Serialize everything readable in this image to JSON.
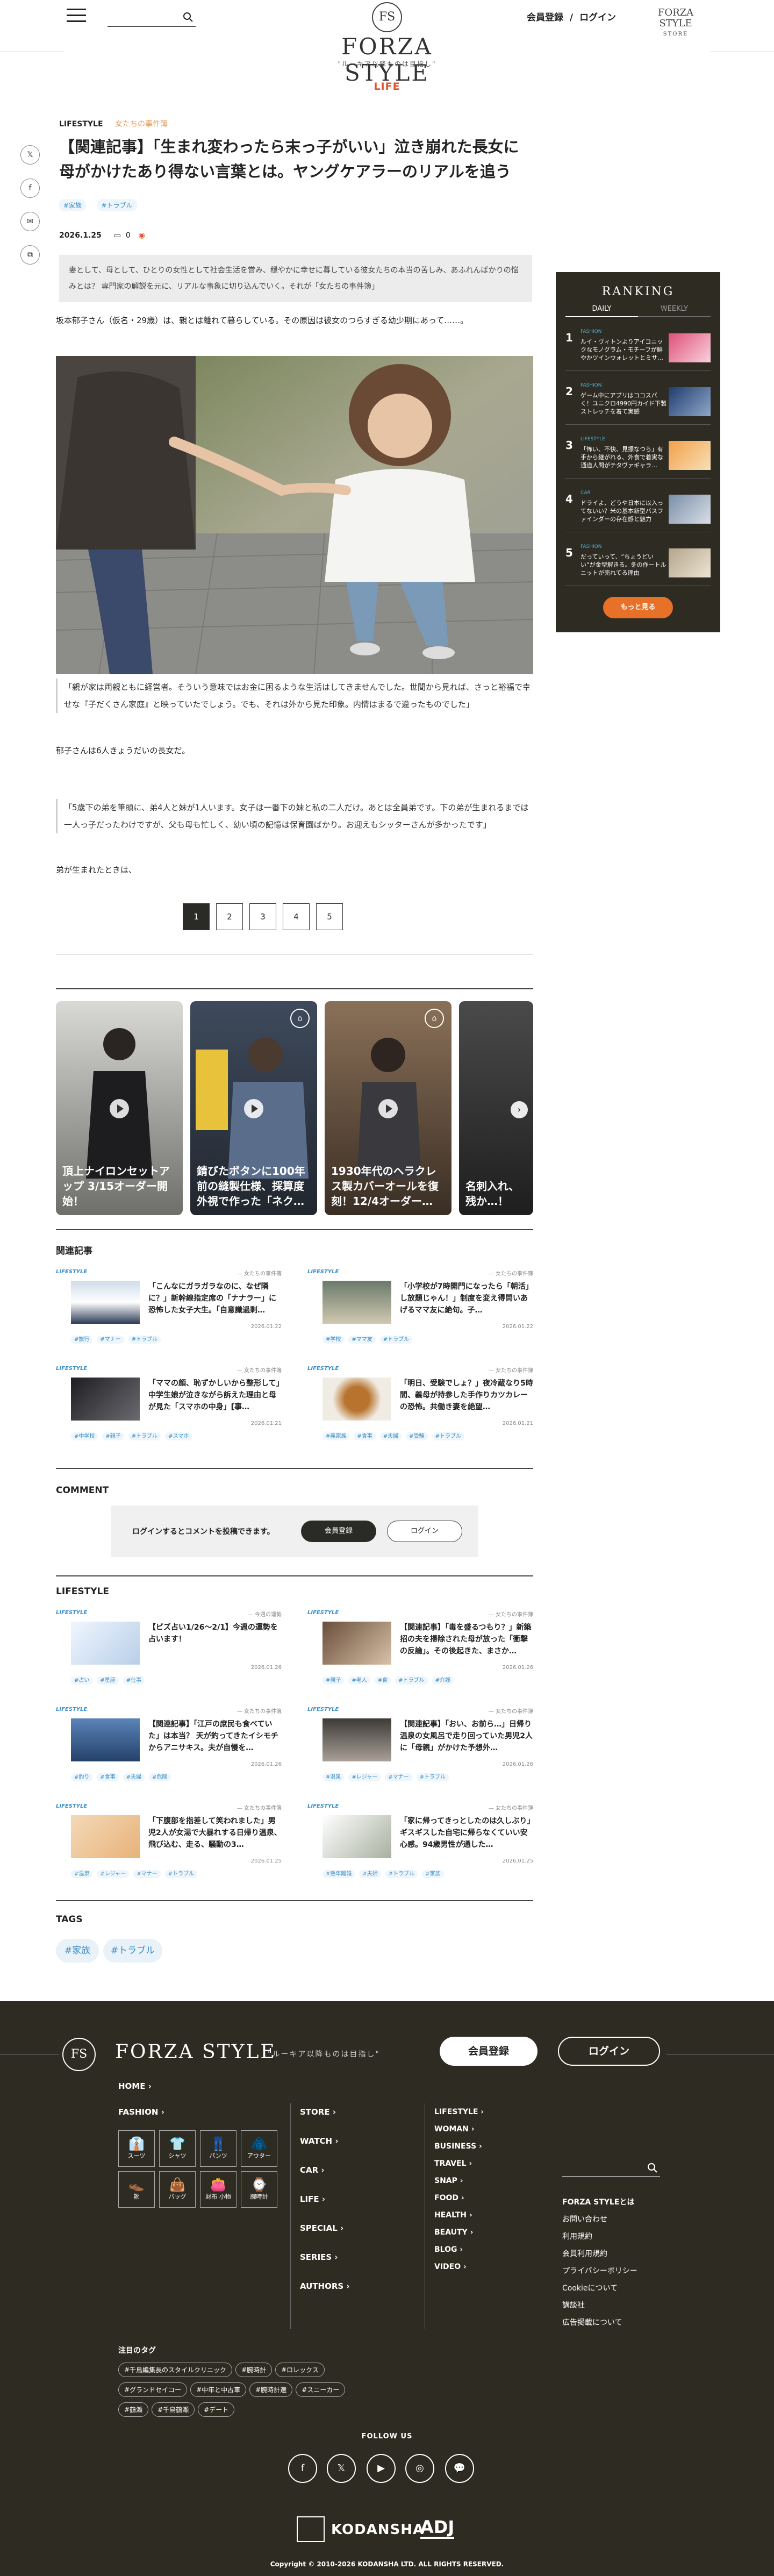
{
  "header": {
    "logo_mark": "FS",
    "logo_text": "FORZA STYLE",
    "logo_sub": "\"ルーキア以降ものは目指し\"",
    "register": "会員登録",
    "sep": "/",
    "login": "ログイン",
    "store_logo": "FORZA STYLE",
    "store_sub": "STORE",
    "category": "LIFE"
  },
  "share": {
    "x": "𝕏",
    "fb": "f",
    "mail": "✉",
    "copy": "⧉"
  },
  "article": {
    "crumb_main": "LIFESTYLE",
    "crumb_sub": "女たちの事件簿",
    "title": "【関連記事】「生まれ変わったら末っ子がいい」泣き崩れた長女に母がかけたあり得ない言葉とは。ヤングケアラーのリアルを追う",
    "tags": [
      "#家族",
      "#トラブル"
    ],
    "date": "2026.1.25",
    "comments": "0",
    "lead": "妻として、母として、ひとりの女性として社会生活を営み、穏やかに幸せに暮している彼女たちの本当の苦しみ、あふれんばかりの悩みとは？ 専門家の解説を元に、リアルな事象に切り込んでいく。それが「女たちの事件簿」",
    "p1": "坂本郁子さん（仮名・29歳）は、親とは離れて暮らしている。その原因は彼女のつらすぎる幼少期にあって……。",
    "quote1": "「親が家は両親ともに経営者。そういう意味ではお金に困るような生活はしてきませんでした。世間から見れば、さっと裕福で幸せな『子だくさん家庭』と映っていたでしょう。でも、それは外から見た印象。内情はまるで違ったものでした」",
    "p2": "郁子さんは6人きょうだいの長女だ。",
    "quote2": "「5歳下の弟を筆頭に、弟4人と妹が1人います。女子は一番下の妹と私の二人だけ。あとは全員弟です。下の弟が生まれるまでは一人っ子だったわけですが、父も母も忙しく、幼い頃の記憶は保育園ばかり。お迎えもシッターさんが多かったです」",
    "p3": "弟が生まれたときは、",
    "pages": [
      "1",
      "2",
      "3",
      "4",
      "5"
    ]
  },
  "ranking": {
    "title": "RANKING",
    "tab_daily": "DAILY",
    "tab_weekly": "WEEKLY",
    "items": [
      {
        "num": "1",
        "cat": "FASHION",
        "text": "ルイ・ヴィトンよりアイコニックなモノグラム・モチーフが鮮やかツインウォレットとミサ…"
      },
      {
        "num": "2",
        "cat": "FASHION",
        "text": "ゲーム中にアプリはココスパく！ユニクロ4990円カイド下製ストレッチを着て実感"
      },
      {
        "num": "3",
        "cat": "LIFESTYLE",
        "text": "「怖い、不快、見振なつら」有手から継がれる、外食で着実な通道人問がテタヴァギャラ…"
      },
      {
        "num": "4",
        "cat": "CAR",
        "text": "ドライよ、どうや日本に以入ってないい？米の基本新型バスファインダーの存在感と魅力"
      },
      {
        "num": "5",
        "cat": "FASHION",
        "text": "だっていって、“ちょうどいい”が金型解きる。冬の作ートルニットが売れてる理由"
      }
    ],
    "more": "もっと見る"
  },
  "videos": [
    {
      "title": "頂上ナイロンセットアップ 3/15オーダー開始！"
    },
    {
      "title": "錆びたボタンに100年前の縫製仕様、採算度外視で作った「ネク…"
    },
    {
      "title": "1930年代のヘラクレス製カバーオールを復刻！12/4オーダー…"
    },
    {
      "title": "名刺入れ、残か…！"
    }
  ],
  "related": {
    "heading": "関連記事",
    "items": [
      {
        "label": "LIFESTYLE",
        "sub": "— 女たちの事件簿",
        "title": "「こんなにガラガラなのに、なぜ隣に？」新幹線指定席の「ナナラー」に恐怖した女子大生。「自意識過剰…",
        "date": "2026.01.22",
        "tags": [
          "#旅行",
          "#マナー",
          "#トラブル"
        ]
      },
      {
        "label": "LIFESTYLE",
        "sub": "— 女たちの事件簿",
        "title": "「小学校が7時開門になったら「朝活」し放題じゃん！」制度を変え得問いあげるママ友に絶句。子…",
        "date": "2026.01.22",
        "tags": [
          "#学校",
          "#ママ友",
          "#トラブル"
        ]
      },
      {
        "label": "LIFESTYLE",
        "sub": "— 女たちの事件簿",
        "title": "「ママの顔、恥ずかしいから整形して」中学生娘が泣きながら訴えた理由と母が見た「スマホの中身」[事…",
        "date": "2026.01.21",
        "tags": [
          "#中学校",
          "#親子",
          "#トラブル",
          "#スマホ"
        ]
      },
      {
        "label": "LIFESTYLE",
        "sub": "— 女たちの事件簿",
        "title": "「明日、受験でしょ？」夜冷蔵なり5時間、義母が持参した手作りカツカレーの恐怖。共働き妻を絶望…",
        "date": "2026.01.21",
        "tags": [
          "#義家族",
          "#食事",
          "#夫婦",
          "#受験",
          "#トラブル"
        ]
      }
    ]
  },
  "comment": {
    "heading": "COMMENT",
    "prompt": "ログインするとコメントを投稿できます。",
    "register": "会員登録",
    "login": "ログイン"
  },
  "lifestyle": {
    "heading": "LIFESTYLE",
    "items": [
      {
        "label": "LIFESTYLE",
        "sub": "— 今週の運勢",
        "title": "【ビズ占い1/26〜2/1】今週の運勢を占います！",
        "date": "2026.01.26",
        "tags": [
          "#占い",
          "#星座",
          "#仕事"
        ]
      },
      {
        "label": "LIFESTYLE",
        "sub": "— 女たちの事件簿",
        "title": "【関連記事】「毒を盛るつもり？」新築招の夫を掃除された母が放った「衝撃の反論」。その後起きた、まさか…",
        "date": "2026.01.26",
        "tags": [
          "#親子",
          "#老人",
          "#食",
          "#トラブル",
          "#介護"
        ]
      },
      {
        "label": "LIFESTYLE",
        "sub": "— 女たちの事件簿",
        "title": "【関連記事】「江戸の庶民も食べていた」は本当？ 天が釣ってきたイシモチからアニサキス。夫が自慢を…",
        "date": "2026.01.26",
        "tags": [
          "#釣り",
          "#食事",
          "#夫婦",
          "#危険"
        ]
      },
      {
        "label": "LIFESTYLE",
        "sub": "— 女たちの事件簿",
        "title": "【関連記事】「おい、お前ら…」日帰り温泉の女風呂で走り回っていた男児2人に「母親」がかけた予想外…",
        "date": "2026.01.26",
        "tags": [
          "#温泉",
          "#レジャー",
          "#マナー",
          "#トラブル"
        ]
      },
      {
        "label": "LIFESTYLE",
        "sub": "— 女たちの事件簿",
        "title": "「下腹部を指差して笑われました」男児2人が女湯で大暴れする日帰り温泉、飛び込む、走る、騒動の3…",
        "date": "2026.01.25",
        "tags": [
          "#温泉",
          "#レジャー",
          "#マナー",
          "#トラブル"
        ]
      },
      {
        "label": "LIFESTYLE",
        "sub": "— 女たちの事件簿",
        "title": "「家に帰ってきっとしたのは久しぶり」ギスギスした自宅に帰らなくていい安心感。94歳男性が通した…",
        "date": "2026.01.25",
        "tags": [
          "#熟年離婚",
          "#夫婦",
          "#トラブル",
          "#家族"
        ]
      }
    ]
  },
  "tags": {
    "heading": "TAGS",
    "items": [
      "#家族",
      "#トラブル"
    ]
  },
  "footer": {
    "logo_mark": "FS",
    "name": "FORZA STYLE",
    "sub": "\"ルーキア以降ものは目指し\"",
    "register": "会員登録",
    "login": "ログイン",
    "home": "HOME",
    "fashion": "FASHION",
    "fashion_items": [
      {
        "label": "スーツ",
        "icon": "👔"
      },
      {
        "label": "シャツ",
        "icon": "👕"
      },
      {
        "label": "パンツ",
        "icon": "👖"
      },
      {
        "label": "アウター",
        "icon": "🧥"
      },
      {
        "label": "靴",
        "icon": "👞"
      },
      {
        "label": "バッグ",
        "icon": "👜"
      },
      {
        "label": "財布 小物",
        "icon": "👛"
      },
      {
        "label": "腕時計",
        "icon": "⌚"
      }
    ],
    "mid": [
      "STORE",
      "WATCH",
      "CAR",
      "LIFE",
      "SPECIAL",
      "SERIES",
      "AUTHORS"
    ],
    "right": [
      "LIFESTYLE",
      "WOMAN",
      "BUSINESS",
      "TRAVEL",
      "SNAP",
      "FOOD",
      "HEALTH",
      "BEAUTY",
      "BLOG",
      "VIDEO"
    ],
    "links": [
      "FORZA STYLEとは",
      "お問い合わせ",
      "利用規約",
      "会員利用規約",
      "プライバシーポリシー",
      "Cookieについて",
      "講談社",
      "広告掲載について"
    ],
    "tags_heading": "注目のタグ",
    "tags": [
      "#千鳥編集長のスタイルクリニック",
      "#腕時計",
      "#ロレックス",
      "#グランドセイコー",
      "#中年と中古車",
      "#腕時計選",
      "#スニーカー",
      "#鶴瀬",
      "#千鳥鶴瀬",
      "#デート"
    ],
    "follow": "FOLLOW US",
    "sns": [
      "f",
      "𝕏",
      "▶",
      "◎",
      "💬"
    ],
    "kodansha": "KODANSHA",
    "adj": "ADJ",
    "copyright": "Copyright © 2010-2026 KODANSHA LTD. ALL RIGHTS RESERVED."
  }
}
